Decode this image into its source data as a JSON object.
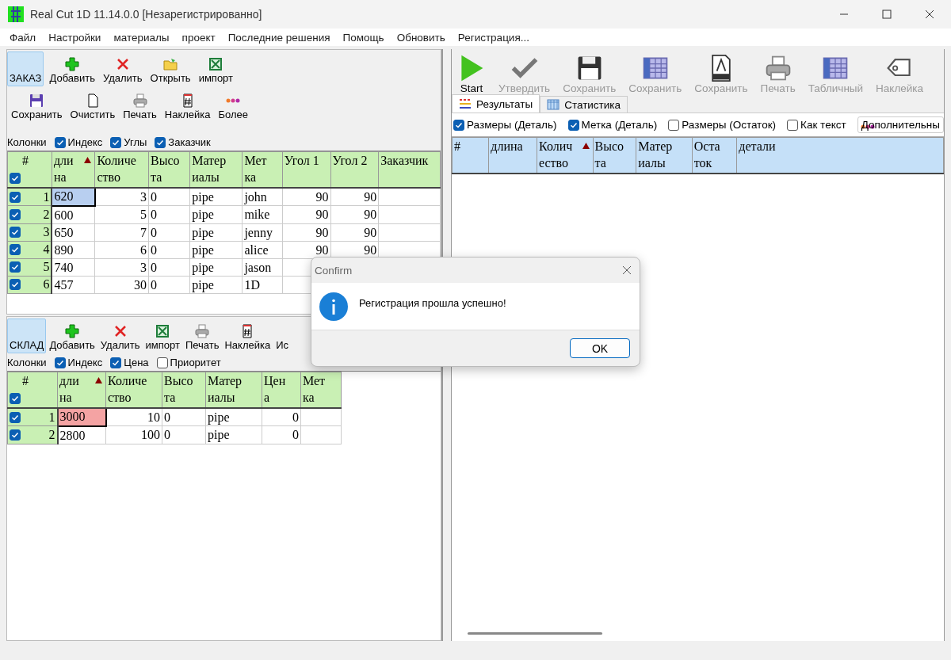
{
  "window": {
    "title": "Real Cut 1D 11.14.0.0 [Незарегистрированно]"
  },
  "menu": [
    "Файл",
    "Настройки",
    "материалы",
    "проект",
    "Последние решения",
    "Помощь",
    "Обновить",
    "Регистрация..."
  ],
  "order_panel": {
    "tab": {
      "label": "ЗАКАЗ",
      "selected": true
    },
    "toolbar_rows": [
      [
        {
          "label": "Добавить",
          "kind": "add"
        },
        {
          "label": "Удалить",
          "kind": "delete"
        },
        {
          "label": "Открыть",
          "kind": "open"
        },
        {
          "label": "импорт",
          "kind": "excel"
        }
      ],
      [
        {
          "label": "Сохранить",
          "kind": "save"
        },
        {
          "label": "Очистить",
          "kind": "clear"
        },
        {
          "label": "Печать",
          "kind": "print"
        },
        {
          "label": "Наклейка",
          "kind": "label"
        },
        {
          "label": "Более",
          "kind": "more"
        }
      ]
    ],
    "columns_label": "Колонки",
    "column_toggles": [
      {
        "label": "Индекс",
        "checked": true
      },
      {
        "label": "Углы",
        "checked": true
      },
      {
        "label": "Заказчик",
        "checked": true
      }
    ],
    "table": {
      "select_all": true,
      "focus_invalid": false,
      "index_header": "#",
      "columns": [
        {
          "label": "дли\nна",
          "sorted": true,
          "numeric": false
        },
        {
          "label": "Количе\nство",
          "sorted": false,
          "numeric": true
        },
        {
          "label": "Высо\nта",
          "sorted": false,
          "numeric": false
        },
        {
          "label": "Матер\nиалы",
          "sorted": false,
          "numeric": false
        },
        {
          "label": "Мет\nка",
          "sorted": false,
          "numeric": false
        },
        {
          "label": "Угол 1",
          "sorted": false,
          "numeric": true
        },
        {
          "label": "Угол 2",
          "sorted": false,
          "numeric": true
        },
        {
          "label": "Заказчик",
          "sorted": false
        }
      ],
      "rows": [
        {
          "checked": true,
          "index": "1",
          "cells": [
            "620",
            "3",
            "0",
            "pipe",
            "john",
            "90",
            "90"
          ]
        },
        {
          "checked": true,
          "index": "2",
          "cells": [
            "600",
            "5",
            "0",
            "pipe",
            "mike",
            "90",
            "90"
          ]
        },
        {
          "checked": true,
          "index": "3",
          "cells": [
            "650",
            "7",
            "0",
            "pipe",
            "jenny",
            "90",
            "90"
          ]
        },
        {
          "checked": true,
          "index": "4",
          "cells": [
            "890",
            "6",
            "0",
            "pipe",
            "alice",
            "90",
            "90"
          ]
        },
        {
          "checked": true,
          "index": "5",
          "cells": [
            "740",
            "3",
            "0",
            "pipe",
            "jason"
          ]
        },
        {
          "checked": true,
          "index": "6",
          "cells": [
            "457",
            "30",
            "0",
            "pipe",
            "1D"
          ]
        }
      ]
    }
  },
  "stock_panel": {
    "tab": {
      "label": "СКЛАД",
      "selected": true
    },
    "toolbar_rows": [
      [
        {
          "label": "Добавить",
          "kind": "add"
        },
        {
          "label": "Удалить",
          "kind": "delete"
        },
        {
          "label": "импорт",
          "kind": "excel"
        },
        {
          "label": "Печать",
          "kind": "print"
        },
        {
          "label": "Наклейка",
          "kind": "label"
        },
        {
          "label": "Ис",
          "kind": "none"
        }
      ]
    ],
    "columns_label": "Колонки",
    "column_toggles": [
      {
        "label": "Индекс",
        "checked": true
      },
      {
        "label": "Цена",
        "checked": true
      },
      {
        "label": "Приоритет",
        "checked": false
      }
    ],
    "table": {
      "select_all": true,
      "focus_invalid": true,
      "index_header": "#",
      "columns": [
        {
          "label": "дли\nна",
          "sorted": true,
          "numeric": false
        },
        {
          "label": "Количе\nство",
          "sorted": false,
          "numeric": true
        },
        {
          "label": "Высо\nта",
          "sorted": false,
          "numeric": false
        },
        {
          "label": "Матер\nиалы",
          "sorted": false,
          "numeric": false
        },
        {
          "label": "Цен\nа",
          "sorted": false,
          "numeric": true
        },
        {
          "label": "Мет\nка",
          "sorted": false
        }
      ],
      "rows": [
        {
          "checked": true,
          "index": "1",
          "cells": [
            "3000",
            "10",
            "0",
            "pipe",
            "0"
          ]
        },
        {
          "checked": true,
          "index": "2",
          "cells": [
            "2800",
            "100",
            "0",
            "pipe",
            "0"
          ]
        }
      ]
    }
  },
  "results_panel": {
    "toolbar": [
      {
        "label": "Start",
        "kind": "start",
        "disabled": false
      },
      {
        "label": "Утвердить",
        "kind": "confirm",
        "disabled": true
      },
      {
        "label": "Сохранить",
        "kind": "save",
        "disabled": true
      },
      {
        "label": "Сохранить",
        "kind": "table",
        "disabled": true
      },
      {
        "label": "Сохранить",
        "kind": "dxf",
        "disabled": true
      },
      {
        "label": "Печать",
        "kind": "print",
        "disabled": true
      },
      {
        "label": "Табличный",
        "kind": "table",
        "disabled": true
      },
      {
        "label": "Наклейка",
        "kind": "tag",
        "disabled": true
      }
    ],
    "tabs": [
      {
        "label": "Результаты",
        "selected": true,
        "kind": "results"
      },
      {
        "label": "Статистика",
        "selected": false,
        "kind": "stats"
      }
    ],
    "options": [
      {
        "label": "Размеры (Деталь)",
        "checked": true
      },
      {
        "label": "Метка (Деталь)",
        "checked": true
      },
      {
        "label": "Размеры (Остаток)",
        "checked": false
      },
      {
        "label": "Как текст",
        "checked": false
      }
    ],
    "more_button": "Дополнительны",
    "table": {
      "index_header": "#",
      "columns": [
        {
          "label": "длина",
          "sorted": false
        },
        {
          "label": "Колич\nество",
          "sorted": true
        },
        {
          "label": "Высо\nта",
          "sorted": false
        },
        {
          "label": "Матер\nиалы",
          "sorted": false
        },
        {
          "label": "Оста\nток",
          "sorted": false
        },
        {
          "label": "детали",
          "sorted": false
        }
      ]
    }
  },
  "dialog": {
    "title": "Confirm",
    "message": "Регистрация прошла успешно!",
    "button": "OK"
  }
}
